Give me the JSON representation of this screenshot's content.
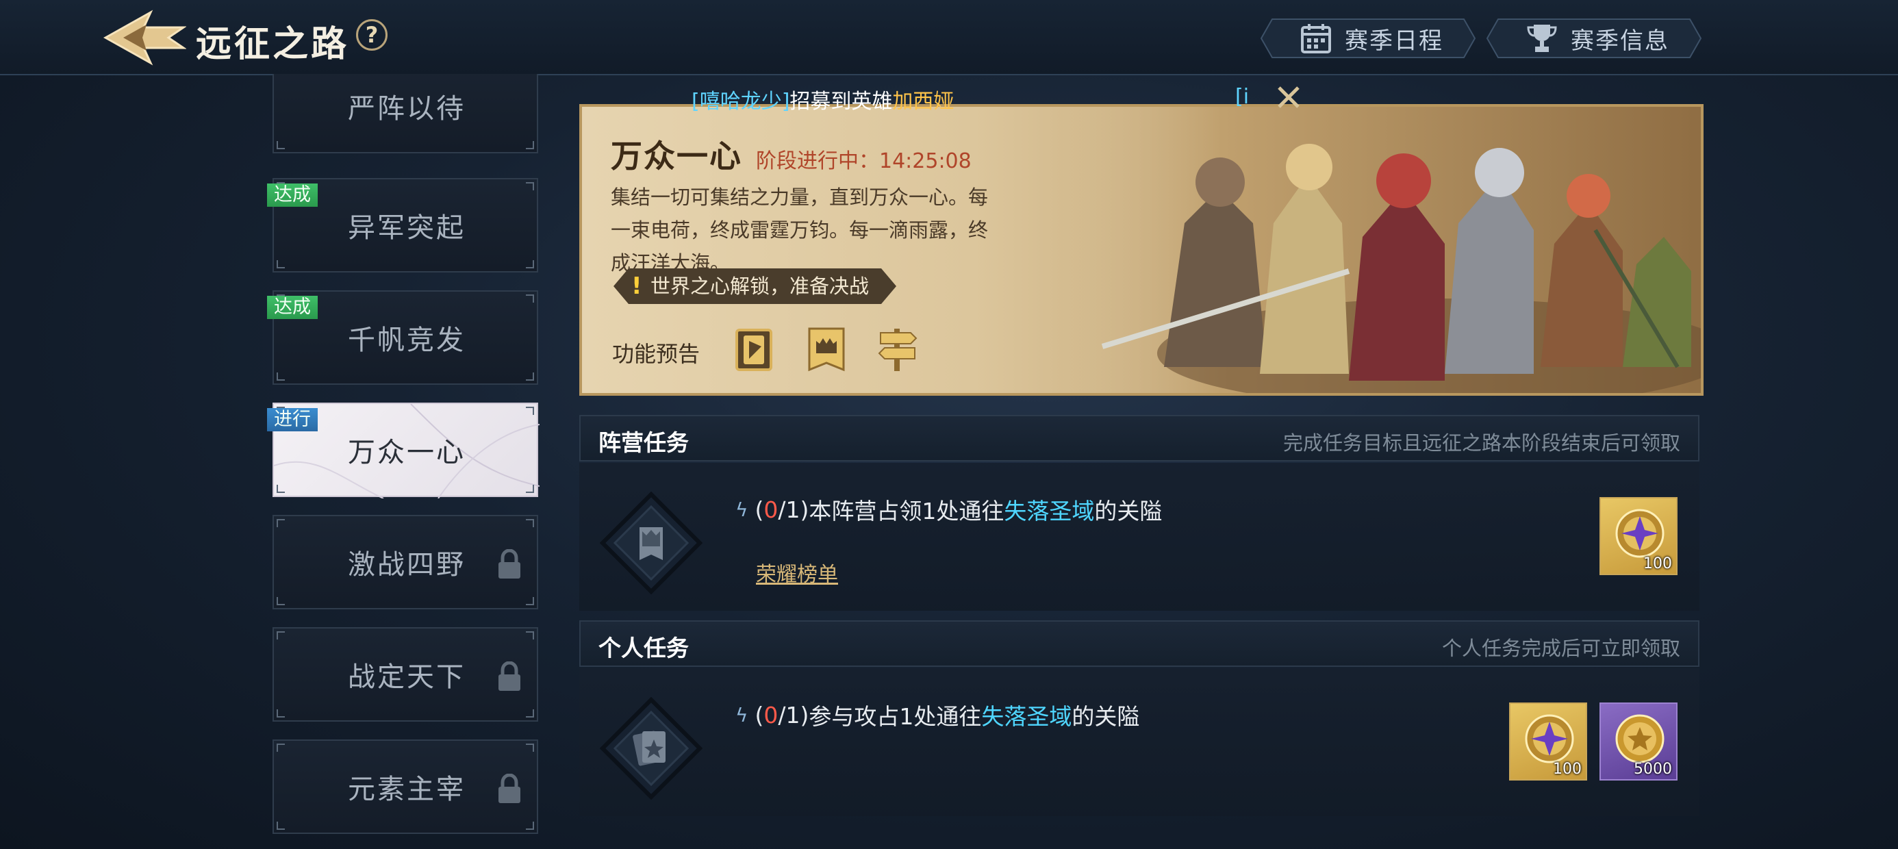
{
  "header": {
    "title": "远征之路",
    "help_symbol": "?",
    "buttons": {
      "schedule": "赛季日程",
      "info": "赛季信息"
    }
  },
  "sidebar": {
    "stages": [
      {
        "name": "严阵以待",
        "status": ""
      },
      {
        "name": "异军突起",
        "status": "达成"
      },
      {
        "name": "千帆竞发",
        "status": "达成"
      },
      {
        "name": "万众一心",
        "status": "进行"
      },
      {
        "name": "激战四野",
        "status": "locked"
      },
      {
        "name": "战定天下",
        "status": "locked"
      },
      {
        "name": "元素主宰",
        "status": "locked"
      }
    ]
  },
  "notice": {
    "player": "[嘻哈龙少]",
    "middle": "招募到英雄",
    "hero": "加西娅",
    "extra": "[i"
  },
  "banner": {
    "title": "万众一心",
    "phase": "阶段进行中：14:25:08",
    "description": "集结一切可集结之力量，直到万众一心。每一束电荷，终成雷霆万钧。每一滴雨露，终成汪洋大海。",
    "unlock_text": "世界之心解锁，准备决战",
    "unlock_mark": "!",
    "preview_label": "功能预告",
    "preview_icons": [
      "card-deck-icon",
      "castle-banner-icon",
      "signpost-icon"
    ]
  },
  "camp_tasks": {
    "title": "阵营任务",
    "hint": "完成任务目标且远征之路本阶段结束后可领取",
    "task": {
      "spark": "ϟ",
      "open": "(",
      "progress": "0",
      "total": "/1)",
      "prefix": "本阵营占领1处通往",
      "location": "失落圣域",
      "suffix": "的关隘",
      "link": "荣耀榜单",
      "rewards": [
        {
          "type": "gold",
          "qty": "100"
        }
      ]
    }
  },
  "personal_tasks": {
    "title": "个人任务",
    "hint": "个人任务完成后可立即领取",
    "task": {
      "spark": "ϟ",
      "open": "(",
      "progress": "0",
      "total": "/1)",
      "prefix": "参与攻占1处通往",
      "location": "失落圣域",
      "suffix": "的关隘",
      "rewards": [
        {
          "type": "gold",
          "qty": "100"
        },
        {
          "type": "purple",
          "qty": "5000"
        }
      ]
    }
  },
  "colors": {
    "accent_gold": "#d8b878",
    "location_cyan": "#4fd6ff",
    "progress_red": "#ff5a4a",
    "badge_done": "#3fbf68",
    "badge_progress": "#3a8dd0"
  }
}
